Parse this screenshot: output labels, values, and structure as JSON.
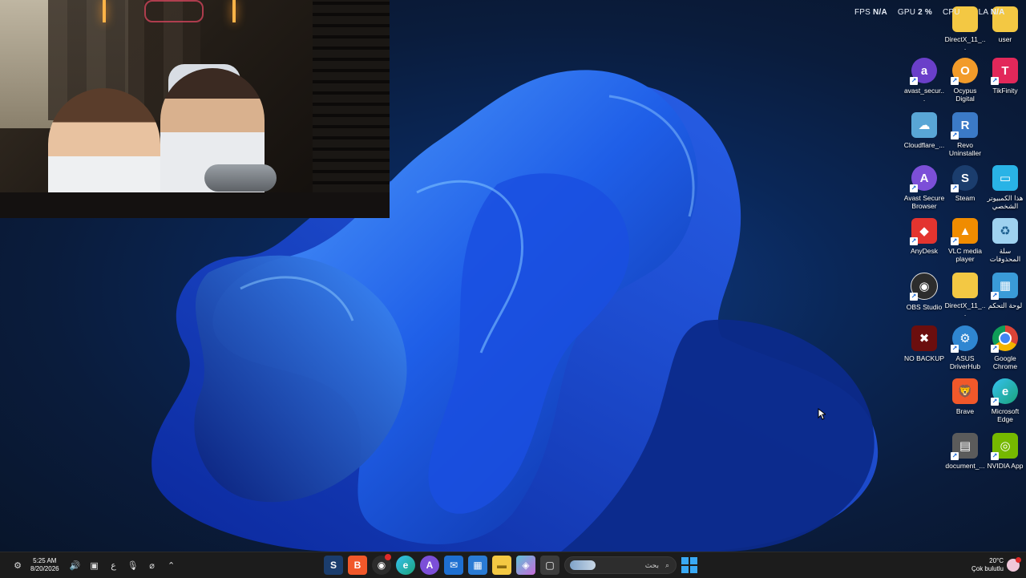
{
  "performance": {
    "fps_label": "FPS",
    "fps_value": "N/A",
    "gpu_label": "GPU",
    "gpu_value": "2 %",
    "cpu_label": "CPU",
    "lat_label": "LA",
    "lat_value": "N/A"
  },
  "desktop_icons": [
    {
      "id": "directx-1",
      "label": "DirectX_11_...",
      "icon": "folder-icon",
      "color": "#f3c843"
    },
    {
      "id": "user",
      "label": "user",
      "icon": "folder-icon",
      "color": "#f3c843"
    },
    {
      "id": "avast-secure",
      "label": "avast_secur...",
      "icon": "avast-icon",
      "color": "#6a3fc9"
    },
    {
      "id": "ocypus",
      "label": "Ocypus Digital",
      "icon": "ocypus-icon",
      "color": "#f29b2a"
    },
    {
      "id": "tikfinity",
      "label": "TikFinity",
      "icon": "tikfinity-icon",
      "color": "#e2285a"
    },
    {
      "id": "cloudflare",
      "label": "Cloudflare_...",
      "icon": "cloudflare-icon",
      "color": "#59a6d6"
    },
    {
      "id": "revo",
      "label": "Revo Uninstaller",
      "icon": "revo-icon",
      "color": "#3b7ac7"
    },
    {
      "id": "avast-browser",
      "label": "Avast Secure Browser",
      "icon": "avast-browser-icon",
      "color": "#7c4fd8"
    },
    {
      "id": "steam",
      "label": "Steam",
      "icon": "steam-icon",
      "color": "#1b3d6d"
    },
    {
      "id": "this-pc",
      "label": "هذا الكمبيوتر الشخصي",
      "icon": "monitor-icon",
      "color": "#29b3e6"
    },
    {
      "id": "anydesk",
      "label": "AnyDesk",
      "icon": "anydesk-icon",
      "color": "#e3342f"
    },
    {
      "id": "vlc",
      "label": "VLC media player",
      "icon": "vlc-icon",
      "color": "#f08c00"
    },
    {
      "id": "recycle",
      "label": "سلة المحذوفات",
      "icon": "recycle-bin-icon",
      "color": "#9fd2f0"
    },
    {
      "id": "obs",
      "label": "OBS Studio",
      "icon": "obs-icon",
      "color": "#2c2c2c"
    },
    {
      "id": "directx-2",
      "label": "DirectX_11_...",
      "icon": "folder-icon",
      "color": "#f3c843"
    },
    {
      "id": "control-panel",
      "label": "لوحة التحكم",
      "icon": "control-panel-icon",
      "color": "#3a9bd8"
    },
    {
      "id": "no-backup",
      "label": "NO BACKUP",
      "icon": "no-backup-icon",
      "color": "#6b0e0e"
    },
    {
      "id": "asus",
      "label": "ASUS DriverHub",
      "icon": "asus-driverhub-icon",
      "color": "#2f86d1"
    },
    {
      "id": "chrome",
      "label": "Google Chrome",
      "icon": "chrome-icon",
      "color": "#e8b41d"
    },
    {
      "id": "brave",
      "label": "Brave",
      "icon": "brave-icon",
      "color": "#f1582a"
    },
    {
      "id": "edge",
      "label": "Microsoft Edge",
      "icon": "edge-icon",
      "color": "#1aa37a"
    },
    {
      "id": "document",
      "label": "document_...",
      "icon": "document-icon",
      "color": "#5b5b5b"
    },
    {
      "id": "nvidia",
      "label": "NVIDIA App",
      "icon": "nvidia-icon",
      "color": "#76b900"
    }
  ],
  "taskbar": {
    "clock_time": "5:25 AM",
    "clock_date": "8/20/2026",
    "ime_label": "ع",
    "search_placeholder": "بحث",
    "weather_temp": "20°C",
    "weather_desc": "Çok bulutlu",
    "pinned_apps": [
      {
        "id": "steam",
        "icon": "steam-icon",
        "color": "#1b3d6d"
      },
      {
        "id": "brave",
        "icon": "brave-icon",
        "color": "#f1582a"
      },
      {
        "id": "obs",
        "icon": "obs-icon",
        "color": "#2c2c2c"
      },
      {
        "id": "edge",
        "icon": "edge-icon",
        "color": "#1aa37a"
      },
      {
        "id": "avast",
        "icon": "avast-browser-icon",
        "color": "#7c4fd8"
      },
      {
        "id": "outlook",
        "icon": "outlook-icon",
        "color": "#1e6fd1"
      },
      {
        "id": "store",
        "icon": "store-icon",
        "color": "#2a7bd4"
      },
      {
        "id": "explorer",
        "icon": "folder-icon",
        "color": "#f3c843"
      },
      {
        "id": "copilot",
        "icon": "copilot-icon",
        "color": "#5fc1d7"
      },
      {
        "id": "taskview",
        "icon": "task-view-icon",
        "color": "#3c3c3c"
      }
    ]
  },
  "colors": {
    "accent": "#39a9f5",
    "taskbar": "#1c1c1c"
  }
}
